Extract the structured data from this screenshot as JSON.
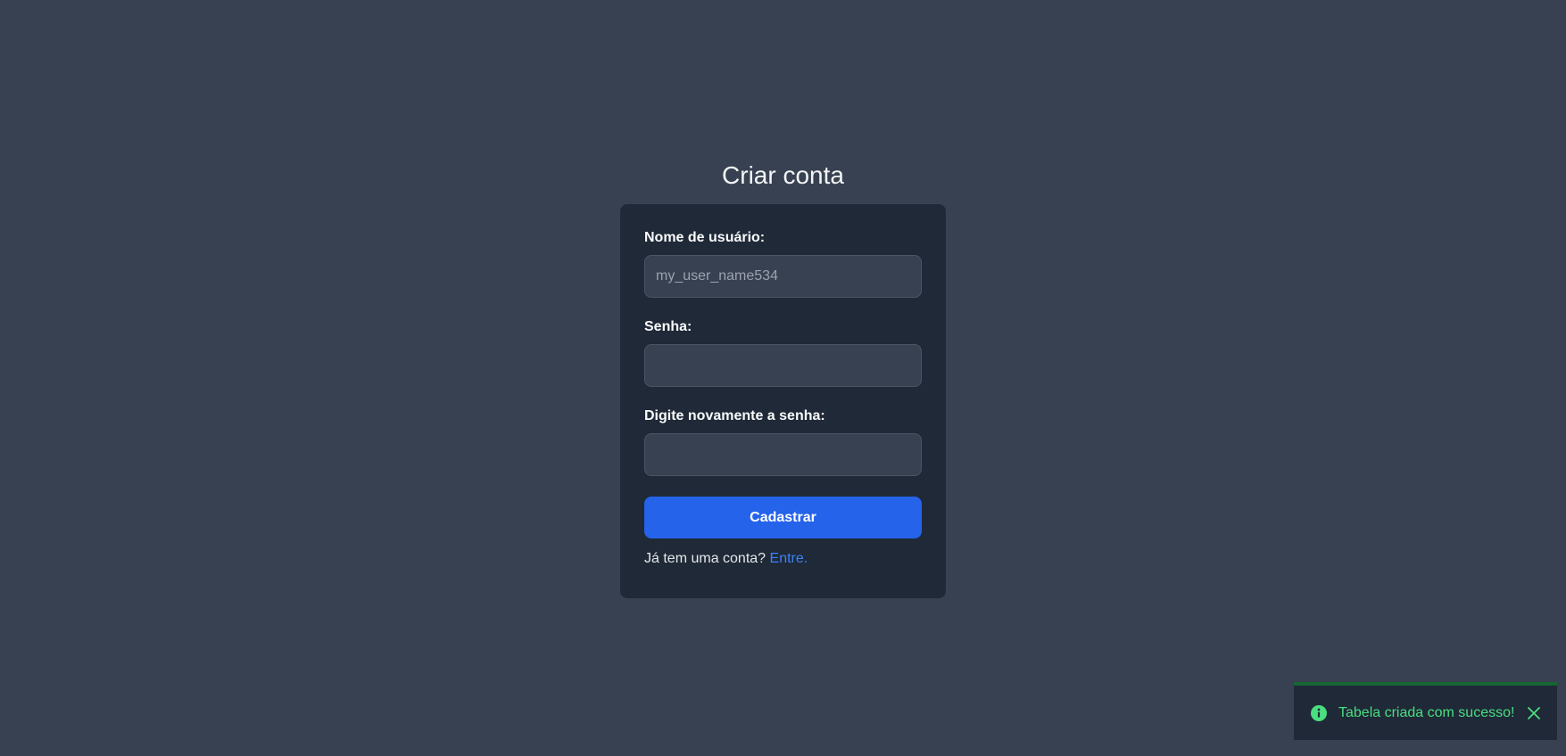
{
  "page": {
    "title": "Criar conta"
  },
  "form": {
    "username": {
      "label": "Nome de usuário:",
      "placeholder": "my_user_name534",
      "value": ""
    },
    "password": {
      "label": "Senha:",
      "placeholder": "",
      "value": ""
    },
    "password_confirm": {
      "label": "Digite novamente a senha:",
      "placeholder": "",
      "value": ""
    },
    "submit_label": "Cadastrar",
    "login_prompt": "Já tem uma conta?",
    "login_link": "Entre."
  },
  "toast": {
    "message": "Tabela criada com sucesso!",
    "icon": "info-icon",
    "close_icon": "close-icon",
    "color": "#4ade80",
    "bar_color": "#166534"
  },
  "colors": {
    "background": "#374151",
    "card": "#1f2937",
    "input": "#374151",
    "accent": "#2563eb",
    "link": "#3b82f6"
  }
}
